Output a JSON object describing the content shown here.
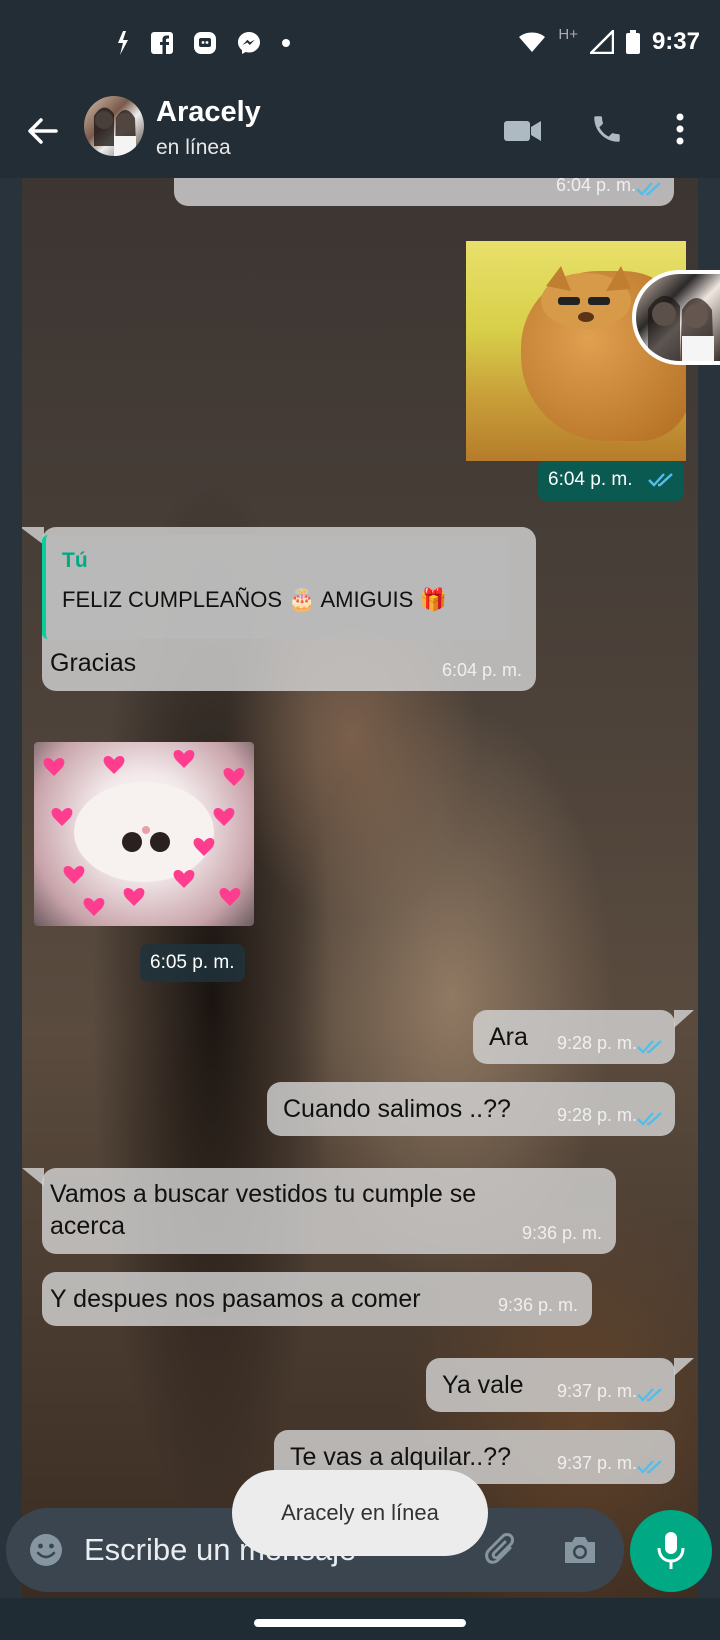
{
  "status_bar": {
    "time": "9:37",
    "network": "H+",
    "icons": [
      "signal-bolt-icon",
      "facebook-icon",
      "messenger-alt-icon",
      "messenger-icon",
      "dot-icon",
      "wifi-icon",
      "cell-signal-icon",
      "battery-icon"
    ]
  },
  "header": {
    "contact_name": "Aracely",
    "contact_status": "en línea",
    "icons": [
      "back-arrow-icon",
      "video-call-icon",
      "phone-icon",
      "more-vert-icon"
    ]
  },
  "messages": [
    {
      "direction": "out",
      "time": "6:04 p. m.",
      "ticks": "read"
    },
    {
      "direction": "out",
      "type": "image",
      "subject": "dog",
      "time": "6:04 p. m.",
      "ticks": "read"
    },
    {
      "direction": "in",
      "quote_author": "Tú",
      "quote_text": "FELIZ CUMPLEAÑOS 🎂 AMIGUIS 🎁",
      "text": "Gracias",
      "time": "6:04 p. m."
    },
    {
      "direction": "in",
      "type": "sticker",
      "subject": "cat-hearts",
      "time": "6:05 p. m."
    },
    {
      "direction": "out",
      "text": "Ara",
      "time": "9:28 p. m.",
      "ticks": "read"
    },
    {
      "direction": "out",
      "text": "Cuando salimos ..??",
      "time": "9:28 p. m.",
      "ticks": "read"
    },
    {
      "direction": "in",
      "text": "Vamos a buscar vestidos tu cumple se acerca",
      "time": "9:36 p. m."
    },
    {
      "direction": "in",
      "text": "Y despues nos pasamos a comer",
      "time": "9:36 p. m."
    },
    {
      "direction": "out",
      "text": "Ya vale",
      "time": "9:37 p. m.",
      "ticks": "read"
    },
    {
      "direction": "out",
      "text": "Te vas a alquilar..??",
      "time": "9:37 p. m.",
      "ticks": "read"
    }
  ],
  "toast": {
    "text": "Aracely en línea"
  },
  "composer": {
    "placeholder": "Escribe un mensaje",
    "icons": [
      "emoji-icon",
      "attach-icon",
      "camera-icon",
      "mic-icon"
    ]
  },
  "colors": {
    "header": "#232d36",
    "accent": "#00a884",
    "ticks": "#53bdeb",
    "composer": "#3b4550"
  }
}
